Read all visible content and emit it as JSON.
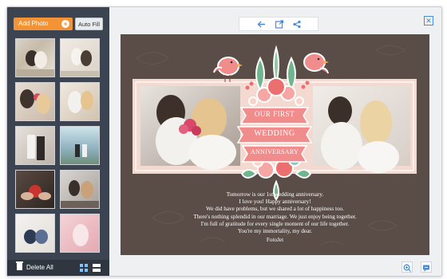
{
  "sidebar": {
    "add_photo_label": "Add Photo",
    "add_photo_icon": "plus-circle-icon",
    "auto_fill_label": "Auto Fill",
    "delete_all_label": "Delete All",
    "grid_view_icon": "grid-view-icon",
    "list_view_icon": "list-view-icon",
    "thumbnail_count": 10
  },
  "toolbar": {
    "back_icon": "arrow-left-icon",
    "open_icon": "open-external-icon",
    "share_icon": "share-icon"
  },
  "window": {
    "close_icon": "close-icon"
  },
  "collage": {
    "banner_lines": [
      "OUR FIRST",
      "WEDDING",
      "ANNIVERSARY"
    ],
    "message_lines": [
      "Tomorrow is our 1st wedding anniversary.",
      "I love you! Happy anniversary!",
      "We did have problems, but we shared a lot of happiness too.",
      "There's nothing splendid in our marriage. We just enjoy being together.",
      "I'm full of gratitude for every single moment of our life together.",
      "You're my immortality, my dear.",
      "FotoJet"
    ]
  },
  "bottom_right": {
    "zoom_icon": "zoom-in-icon",
    "chat_icon": "chat-icon"
  },
  "colors": {
    "accent": "#f29436",
    "sidebar_bg": "#3b4450",
    "canvas_bg": "#5a4d48",
    "icon_blue": "#4a8ad6",
    "banner_pink": "#f08c8c"
  }
}
